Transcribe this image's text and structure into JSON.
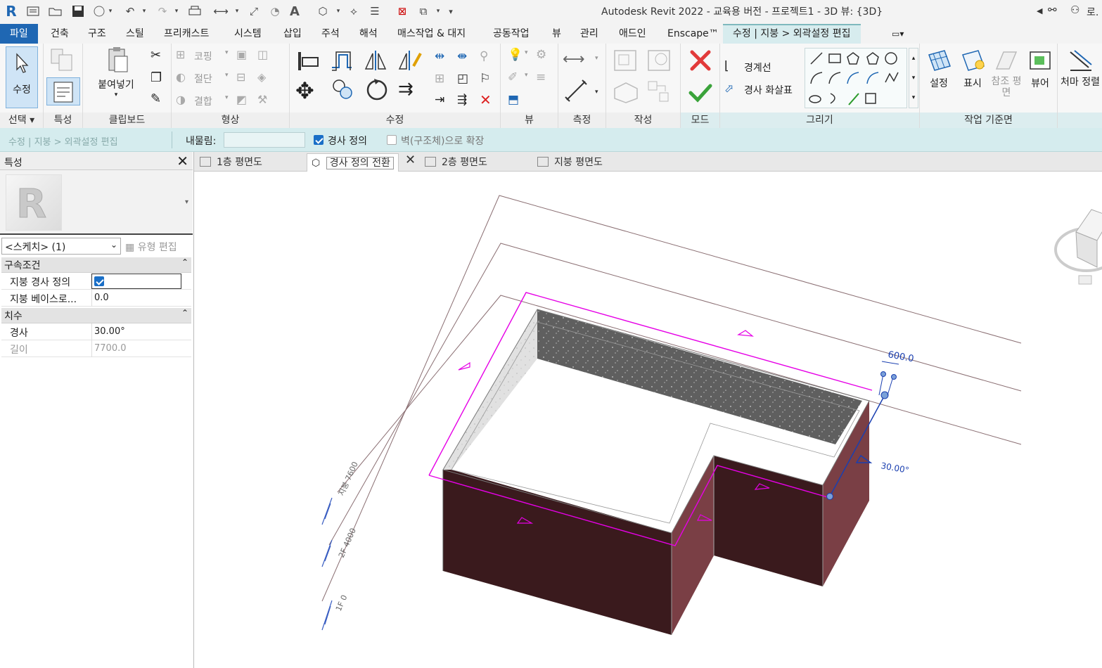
{
  "window": {
    "title": "Autodesk Revit 2022 - 교육용 버전 - 프로젝트1 - 3D 뷰: {3D}",
    "user_initial": "로."
  },
  "ribbon_tabs": [
    "파일",
    "건축",
    "구조",
    "스틸",
    "프리캐스트",
    "시스템",
    "삽입",
    "주석",
    "해석",
    "매스작업 & 대지",
    "공동작업",
    "뷰",
    "관리",
    "애드인",
    "Enscape™",
    "수정 | 지붕 > 외곽설정 편집"
  ],
  "panels": {
    "select": {
      "title": "선택",
      "modify_label": "수정"
    },
    "properties": {
      "title": "특성"
    },
    "clipboard": {
      "title": "클립보드",
      "paste_label": "붙여넣기"
    },
    "geometry": {
      "title": "형상",
      "cope": "코핑",
      "cut": "절단",
      "join": "결합"
    },
    "modify": {
      "title": "수정"
    },
    "view": {
      "title": "뷰"
    },
    "measure": {
      "title": "측정"
    },
    "create": {
      "title": "작성"
    },
    "mode": {
      "title": "모드"
    },
    "draw": {
      "title": "그리기",
      "boundary_line": "경계선",
      "slope_arrow": "경사 화살표"
    },
    "workplane": {
      "title": "작업 기준면",
      "set": "설정",
      "show": "표시",
      "ref_plane": "참조 평면",
      "viewer": "뷰어"
    },
    "eave": {
      "label": "처마 정렬"
    }
  },
  "options_bar": {
    "breadcrumb": "수정 | 지붕 > 외곽설정 편집",
    "overhang_label": "내물림:",
    "defines_slope_label": "경사 정의",
    "defines_slope_checked": true,
    "extend_label": "벽(구조체)으로 확장",
    "extend_checked": false
  },
  "properties_palette": {
    "title": "특성",
    "selection": "<스케치> (1)",
    "edit_type": "유형 편집",
    "groups": [
      {
        "name": "구속조건",
        "rows": [
          {
            "key": "지붕 경사 정의",
            "value": "",
            "checkbox": true
          },
          {
            "key": "지붕 베이스로...",
            "value": "0.0"
          }
        ]
      },
      {
        "name": "치수",
        "rows": [
          {
            "key": "경사",
            "value": "30.00°"
          },
          {
            "key": "길이",
            "value": "7700.0",
            "dim": true
          }
        ]
      }
    ]
  },
  "view_tabs": [
    {
      "label": "1층 평면도",
      "active": false
    },
    {
      "label": "경사 정의 전환",
      "active": true,
      "tooltip": true
    },
    {
      "label": "2층 평면도",
      "active": false
    },
    {
      "label": "지붕 평면도",
      "active": false
    }
  ],
  "viewport": {
    "dim_width": "600.0",
    "slope_value": "30.00°",
    "levels": [
      "지붕 7600",
      "2F 4000",
      "1F 0"
    ]
  },
  "colors": {
    "accent": "#1f67b3",
    "sketch": "#e600e6",
    "context_tab": "#d7ecee",
    "wall_dark": "#3a1a1d",
    "wall_mid": "#7a3f45"
  }
}
